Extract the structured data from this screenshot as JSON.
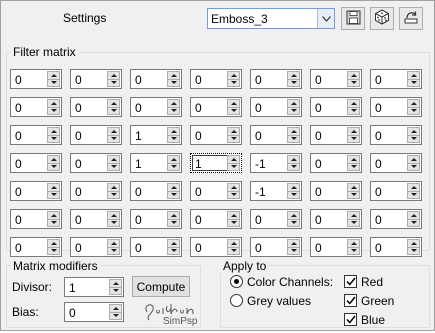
{
  "header": {
    "settings_label": "Settings",
    "preset_value": "Emboss_3",
    "icons": [
      "save-icon",
      "randomize-dice-icon",
      "reset-icon"
    ]
  },
  "filter_matrix": {
    "title": "Filter matrix",
    "rows": [
      [
        "0",
        "0",
        "0",
        "0",
        "0",
        "0",
        "0"
      ],
      [
        "0",
        "0",
        "0",
        "0",
        "0",
        "0",
        "0"
      ],
      [
        "0",
        "0",
        "1",
        "0",
        "0",
        "0",
        "0"
      ],
      [
        "0",
        "0",
        "1",
        "1",
        "-1",
        "0",
        "0"
      ],
      [
        "0",
        "0",
        "0",
        "0",
        "-1",
        "0",
        "0"
      ],
      [
        "0",
        "0",
        "0",
        "0",
        "0",
        "0",
        "0"
      ],
      [
        "0",
        "0",
        "0",
        "0",
        "0",
        "0",
        "0"
      ]
    ],
    "focused_cell": "3,3"
  },
  "modifiers": {
    "title": "Matrix modifiers",
    "divisor_label": "Divisor:",
    "divisor_value": "1",
    "bias_label": "Bias:",
    "bias_value": "0",
    "compute_label": "Compute"
  },
  "apply_to": {
    "title": "Apply to",
    "color_channels_label": "Color Channels:",
    "grey_values_label": "Grey values",
    "selected": "color_channels",
    "red_label": "Red",
    "green_label": "Green",
    "blue_label": "Blue",
    "red_checked": true,
    "green_checked": true,
    "blue_checked": true
  },
  "watermark": {
    "text": "SimPsp"
  },
  "colors": {
    "window_bg": "#f0f0f0",
    "combo_border": "#7a9cd3",
    "group_border": "#d5dfe5"
  }
}
